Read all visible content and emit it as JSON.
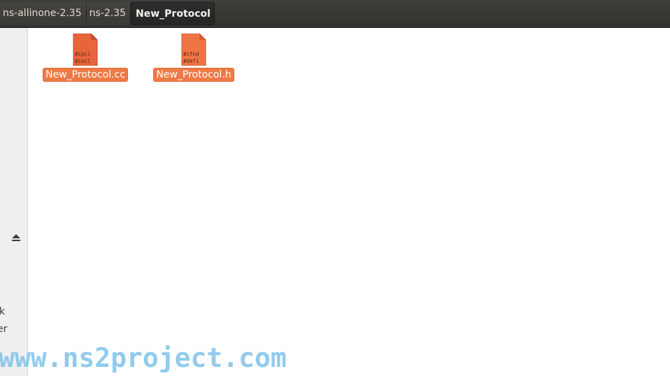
{
  "breadcrumbs": [
    {
      "label": "ns-allinone-2.35"
    },
    {
      "label": "ns-2.35"
    },
    {
      "label": "New_Protocol",
      "active": true
    }
  ],
  "sidebar": {
    "partial_labels": [
      "k",
      "er"
    ],
    "eject_icon": "eject-icon"
  },
  "files": [
    {
      "name": "New_Protocol.cc",
      "preview_lines": [
        "#incl",
        "#incl"
      ],
      "icon": "text-cpp-file-icon",
      "icon_color": "#e8643a"
    },
    {
      "name": "New_Protocol.h",
      "preview_lines": [
        "#ifnd",
        "#defi"
      ],
      "icon": "text-header-file-icon",
      "icon_color": "#f07545"
    }
  ],
  "colors": {
    "selection": "#ee7a45",
    "topbar": "#3c3b37",
    "sidebar": "#efefee"
  },
  "watermark": "www.ns2project.com"
}
